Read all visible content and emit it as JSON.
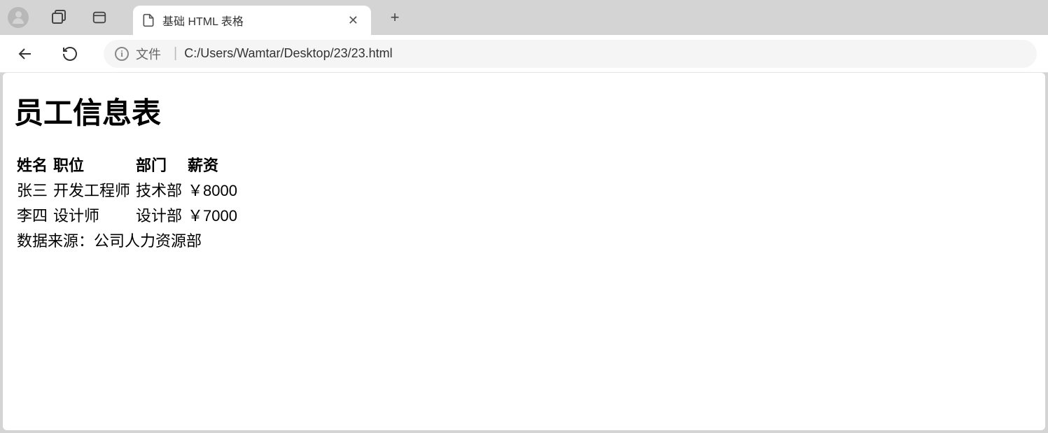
{
  "browser": {
    "tab_title": "基础 HTML 表格",
    "address_prefix": "文件",
    "address_path": "C:/Users/Wamtar/Desktop/23/23.html"
  },
  "page": {
    "heading": "员工信息表",
    "headers": [
      "姓名",
      "职位",
      "部门",
      "薪资"
    ],
    "rows": [
      [
        "张三",
        "开发工程师",
        "技术部",
        "￥8000"
      ],
      [
        "李四",
        "设计师",
        "设计部",
        "￥7000"
      ]
    ],
    "footer": "数据来源：公司人力资源部"
  }
}
